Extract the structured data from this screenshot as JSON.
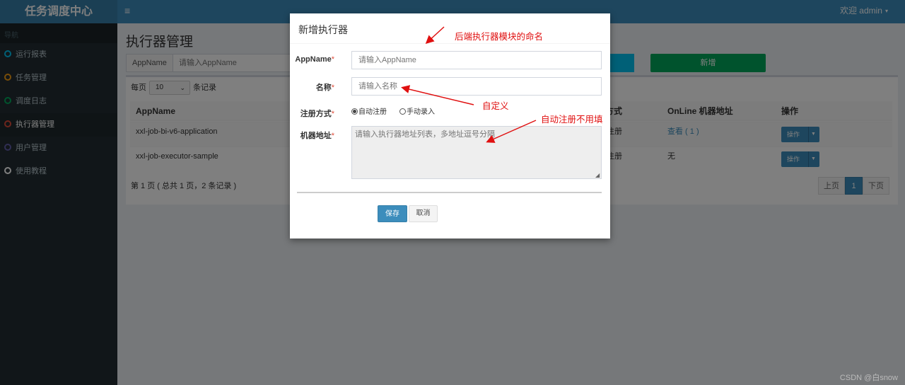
{
  "header": {
    "logo": "任务调度中心",
    "toggle_glyph": "≡",
    "user": "欢迎 admin",
    "user_caret": "▾"
  },
  "sidebar": {
    "header": "导航",
    "items": [
      {
        "label": "运行报表",
        "color": "#00c0ef"
      },
      {
        "label": "任务管理",
        "color": "#f39c12"
      },
      {
        "label": "调度日志",
        "color": "#00a65a"
      },
      {
        "label": "执行器管理",
        "color": "#dd4b39"
      },
      {
        "label": "用户管理",
        "color": "#605ca8"
      },
      {
        "label": "使用教程",
        "color": "#ffffff"
      }
    ]
  },
  "page": {
    "title": "执行器管理",
    "search_addon": "AppName",
    "search_placeholder": "请输入AppName",
    "add_button": "新增",
    "per_page_prefix": "每页",
    "per_page_value": "10",
    "per_page_suffix": "条记录",
    "columns": {
      "appname": "AppName",
      "type": "方式",
      "online": "OnLine 机器地址",
      "action": "操作"
    },
    "rows": [
      {
        "appname": "xxl-job-bi-v6-application",
        "type": "注册",
        "online": "查看 ( 1 )",
        "action": "操作"
      },
      {
        "appname": "xxl-job-executor-sample",
        "type": "注册",
        "online": "无",
        "action": "操作"
      }
    ],
    "pager_info": "第 1 页 ( 总共 1 页，2 条记录 )",
    "pager": {
      "prev": "上页",
      "current": "1",
      "next": "下页"
    }
  },
  "modal": {
    "title": "新增执行器",
    "fields": {
      "appname_label": "AppName",
      "appname_placeholder": "请输入AppName",
      "name_label": "名称",
      "name_placeholder": "请输入名称",
      "reg_label": "注册方式",
      "reg_auto": "自动注册",
      "reg_manual": "手动录入",
      "addr_label": "机器地址",
      "addr_placeholder": "请输入执行器地址列表，多地址逗号分隔"
    },
    "required_mark": "*",
    "save": "保存",
    "cancel": "取消"
  },
  "annotations": {
    "appname_note": "后端执行器模块的命名",
    "name_note": "自定义",
    "addr_note": "自动注册不用填",
    "color": "#e01010"
  },
  "watermark": "CSDN @白snow"
}
